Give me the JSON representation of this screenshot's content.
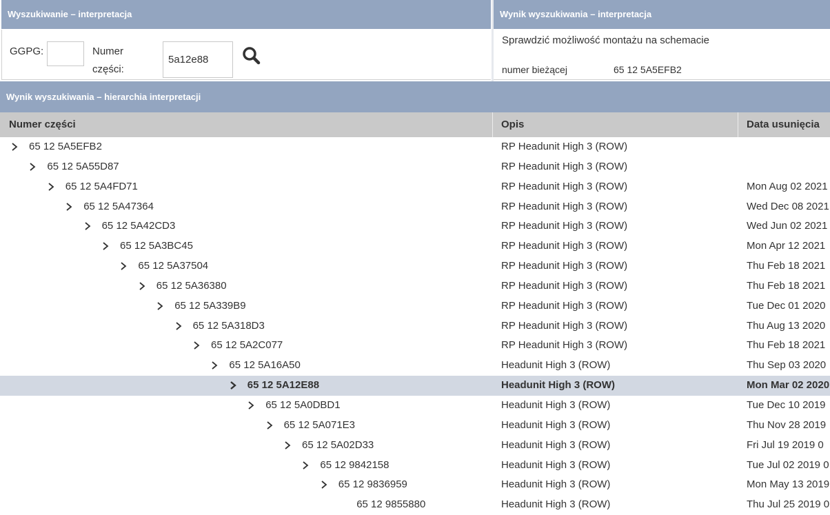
{
  "search_panel": {
    "title": "Wyszukiwanie – interpretacja",
    "ggpg_label": "GGPG:",
    "ggpg_value": "",
    "part_label_line1": "Numer",
    "part_label_line2": "części:",
    "part_value": "5a12e88",
    "search_icon": "magnifier-icon"
  },
  "result_panel": {
    "title": "Wynik wyszukiwania – interpretacja",
    "message": "Sprawdzić możliwość montażu na schemacie",
    "current_label": "numer bieżącej",
    "current_value": "65 12 5A5EFB2"
  },
  "hierarchy": {
    "title": "Wynik wyszukiwania – hierarchia interpretacji",
    "columns": [
      "Numer części",
      "Opis",
      "Data usunięcia"
    ],
    "rows": [
      {
        "part": "65 12 5A5EFB2",
        "desc": "RP Headunit High 3 (ROW)",
        "date": "",
        "level": 0,
        "expandable": true,
        "selected": false
      },
      {
        "part": "65 12 5A55D87",
        "desc": "RP Headunit High 3 (ROW)",
        "date": "",
        "level": 1,
        "expandable": true,
        "selected": false
      },
      {
        "part": "65 12 5A4FD71",
        "desc": "RP Headunit High 3 (ROW)",
        "date": "Mon Aug 02 2021",
        "level": 2,
        "expandable": true,
        "selected": false
      },
      {
        "part": "65 12 5A47364",
        "desc": "RP Headunit High 3 (ROW)",
        "date": "Wed Dec 08 2021",
        "level": 3,
        "expandable": true,
        "selected": false
      },
      {
        "part": "65 12 5A42CD3",
        "desc": "RP Headunit High 3 (ROW)",
        "date": "Wed Jun 02 2021",
        "level": 4,
        "expandable": true,
        "selected": false
      },
      {
        "part": "65 12 5A3BC45",
        "desc": "RP Headunit High 3 (ROW)",
        "date": "Mon Apr 12 2021",
        "level": 5,
        "expandable": true,
        "selected": false
      },
      {
        "part": "65 12 5A37504",
        "desc": "RP Headunit High 3 (ROW)",
        "date": "Thu Feb 18 2021",
        "level": 6,
        "expandable": true,
        "selected": false
      },
      {
        "part": "65 12 5A36380",
        "desc": "RP Headunit High 3 (ROW)",
        "date": "Thu Feb 18 2021",
        "level": 7,
        "expandable": true,
        "selected": false
      },
      {
        "part": "65 12 5A339B9",
        "desc": "RP Headunit High 3 (ROW)",
        "date": "Tue Dec 01 2020",
        "level": 8,
        "expandable": true,
        "selected": false
      },
      {
        "part": "65 12 5A318D3",
        "desc": "RP Headunit High 3 (ROW)",
        "date": "Thu Aug 13 2020",
        "level": 9,
        "expandable": true,
        "selected": false
      },
      {
        "part": "65 12 5A2C077",
        "desc": "RP Headunit High 3 (ROW)",
        "date": "Thu Feb 18 2021",
        "level": 10,
        "expandable": true,
        "selected": false
      },
      {
        "part": "65 12 5A16A50",
        "desc": "Headunit High 3 (ROW)",
        "date": "Thu Sep 03 2020",
        "level": 11,
        "expandable": true,
        "selected": false
      },
      {
        "part": "65 12 5A12E88",
        "desc": "Headunit High 3 (ROW)",
        "date": "Mon Mar 02 2020",
        "level": 12,
        "expandable": true,
        "selected": true
      },
      {
        "part": "65 12 5A0DBD1",
        "desc": "Headunit High 3 (ROW)",
        "date": "Tue Dec 10 2019",
        "level": 13,
        "expandable": true,
        "selected": false
      },
      {
        "part": "65 12 5A071E3",
        "desc": "Headunit High 3 (ROW)",
        "date": "Thu Nov 28 2019",
        "level": 14,
        "expandable": true,
        "selected": false
      },
      {
        "part": "65 12 5A02D33",
        "desc": "Headunit High 3 (ROW)",
        "date": "Fri Jul 19 2019 0",
        "level": 15,
        "expandable": true,
        "selected": false
      },
      {
        "part": "65 12 9842158",
        "desc": "Headunit High 3 (ROW)",
        "date": "Tue Jul 02 2019 0",
        "level": 16,
        "expandable": true,
        "selected": false
      },
      {
        "part": "65 12 9836959",
        "desc": "Headunit High 3 (ROW)",
        "date": "Mon May 13 2019",
        "level": 17,
        "expandable": true,
        "selected": false
      },
      {
        "part": "65 12 9855880",
        "desc": "Headunit High 3 (ROW)",
        "date": "Thu Jul 25 2019 0",
        "level": 18,
        "expandable": false,
        "selected": false
      }
    ]
  },
  "colors": {
    "header_bg": "#93a5c0",
    "column_header_bg": "#c9c9c9",
    "selected_row_bg": "#d2d8e2"
  }
}
